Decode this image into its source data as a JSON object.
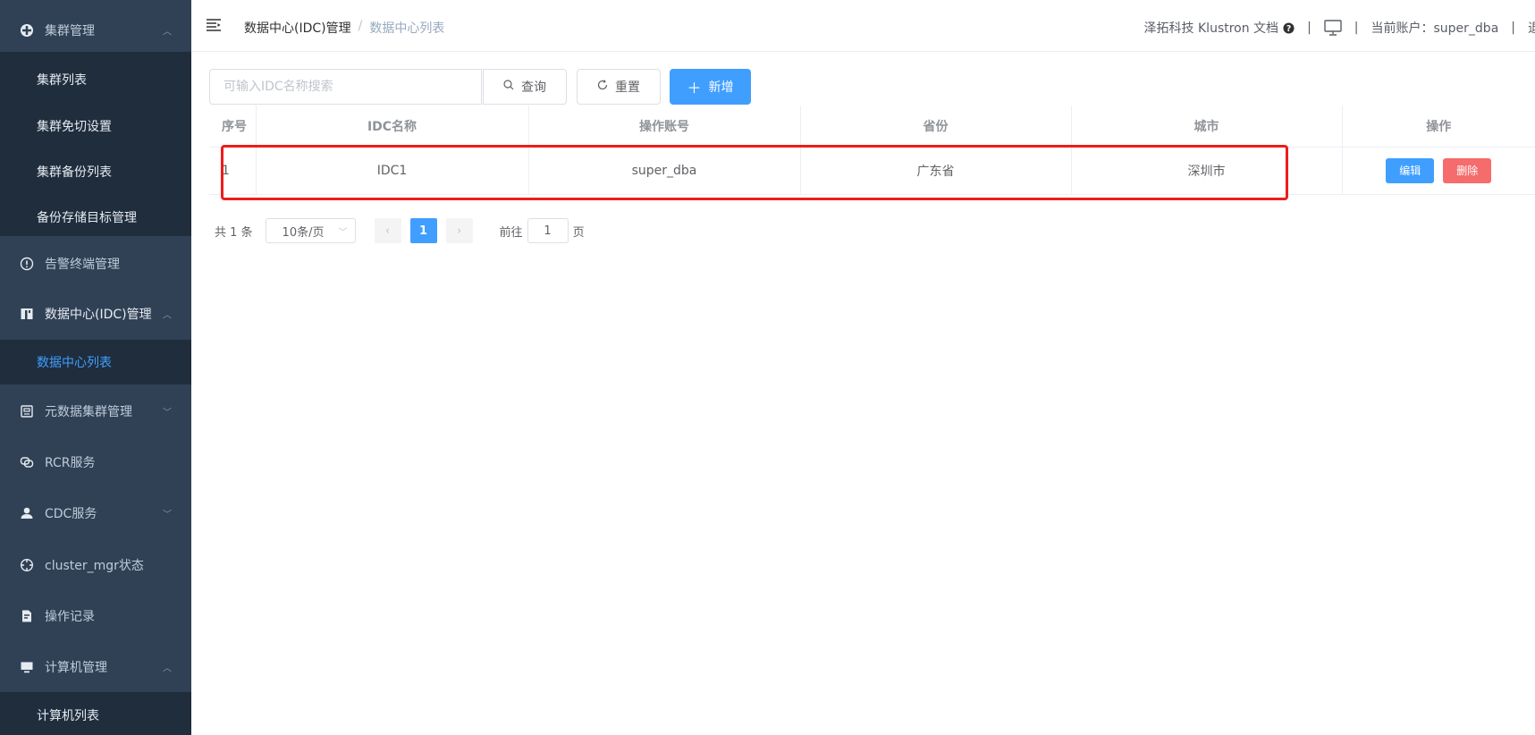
{
  "sidebar": {
    "cluster_group": {
      "label": "集群管理",
      "icon": "cluster-icon"
    },
    "cluster_subs": [
      "集群列表",
      "集群免切设置",
      "集群备份列表",
      "备份存储目标管理"
    ],
    "alarm": {
      "label": "告警终端管理",
      "icon": "alert-icon"
    },
    "idc_group": {
      "label": "数据中心(IDC)管理",
      "icon": "building-icon"
    },
    "idc_subs": [
      "数据中心列表"
    ],
    "meta": {
      "label": "元数据集群管理",
      "icon": "database-icon"
    },
    "rcr": {
      "label": "RCR服务",
      "icon": "link-icon"
    },
    "cdc": {
      "label": "CDC服务",
      "icon": "user-icon"
    },
    "cluster_mgr": {
      "label": "cluster_mgr状态",
      "icon": "target-icon"
    },
    "oplog": {
      "label": "操作记录",
      "icon": "document-icon"
    },
    "computer_group": {
      "label": "计算机管理",
      "icon": "monitor-icon"
    },
    "computer_subs": [
      "计算机列表"
    ]
  },
  "header": {
    "breadcrumb_parent": "数据中心(IDC)管理",
    "breadcrumb_sep": "/",
    "breadcrumb_current": "数据中心列表",
    "brand_link": "泽拓科技 Klustron 文档",
    "separator": "|",
    "account_label": "当前账户：super_dba",
    "cut_text": "退"
  },
  "toolbar": {
    "search_placeholder": "可输入IDC名称搜索",
    "query_label": "查询",
    "reset_label": "重置",
    "add_label": "新增"
  },
  "table": {
    "columns": [
      "序号",
      "IDC名称",
      "操作账号",
      "省份",
      "城市",
      "操作"
    ],
    "rows": [
      {
        "index": "1",
        "name": "IDC1",
        "account": "super_dba",
        "province": "广东省",
        "city": "深圳市"
      }
    ],
    "edit_label": "编辑",
    "delete_label": "删除"
  },
  "pagination": {
    "total": "共 1 条",
    "page_size": "10条/页",
    "current_page": "1",
    "goto_label": "前往",
    "goto_value": "1",
    "page_suffix": "页"
  },
  "colors": {
    "sidebar_bg": "#304156",
    "submenu_bg": "#1f2d3d",
    "primary": "#409eff",
    "danger": "#f56c6c",
    "highlight": "#ee1c1c"
  }
}
